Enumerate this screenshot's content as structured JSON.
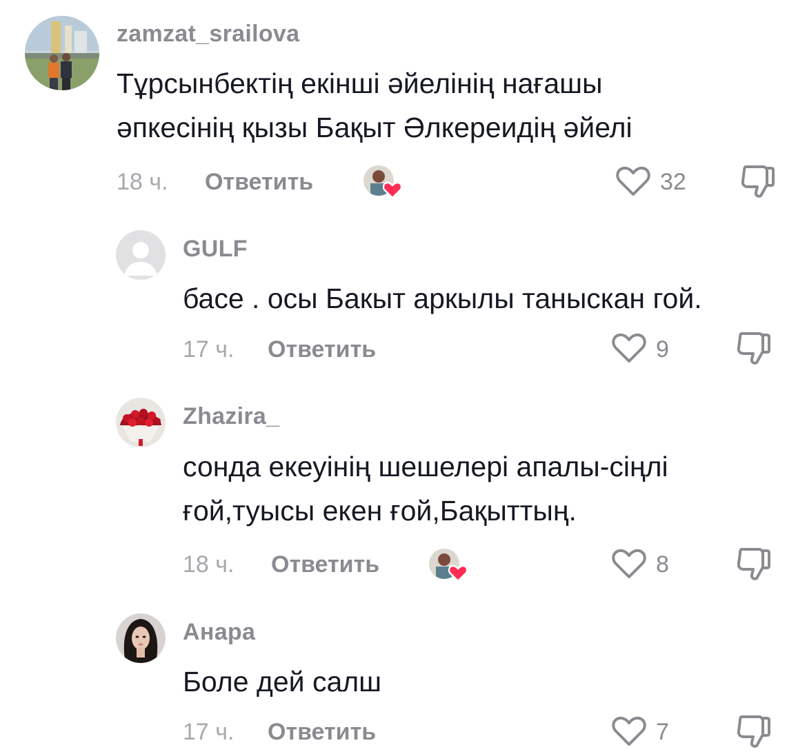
{
  "comments": [
    {
      "username": "zamzat_srailova",
      "text_lines": [
        "Тұрсынбектің екінші әйелінің нағашы",
        "әпкесінің қызы Бақыт Әлкереидің әйелі"
      ],
      "time": "18 ч.",
      "reply_label": "Ответить",
      "likes": "32",
      "liked_by_creator": true
    },
    {
      "username": "GULF",
      "text_lines": [
        "басе . осы Бакыт аркылы таныскан гой."
      ],
      "time": "17 ч.",
      "reply_label": "Ответить",
      "likes": "9",
      "liked_by_creator": false
    },
    {
      "username": "Zhazira_",
      "text_lines": [
        "сонда екеуінің шешелері апалы-сіңлі",
        "ғой,туысы екен ғой,Бақыттың."
      ],
      "time": "18 ч.",
      "reply_label": "Ответить",
      "likes": "8",
      "liked_by_creator": true
    },
    {
      "username": "Анара",
      "text_lines": [
        "Боле дей салш"
      ],
      "time": "17 ч.",
      "reply_label": "Ответить",
      "likes": "7",
      "liked_by_creator": false
    }
  ],
  "icons": {
    "like": "heart-outline-icon",
    "dislike": "thumbs-down-icon",
    "creator_like": "heart-filled-icon"
  },
  "colors": {
    "heart_red": "#fe2c55",
    "meta_gray": "#8a8b91",
    "text": "#161823"
  }
}
